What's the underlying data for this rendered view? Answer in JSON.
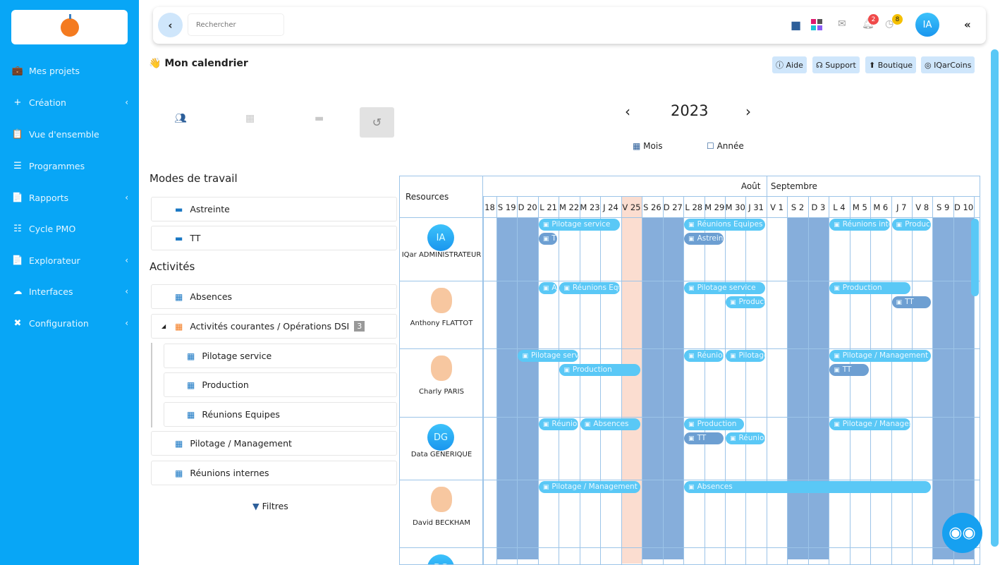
{
  "sidebar": {
    "items": [
      {
        "label": "Mes projets",
        "icon": "briefcase-icon",
        "glyph": "💼",
        "chevron": false
      },
      {
        "label": "Création",
        "icon": "plus-icon",
        "glyph": "+",
        "chevron": true
      },
      {
        "label": "Vue d'ensemble",
        "icon": "clipboard-icon",
        "glyph": "📋",
        "chevron": false
      },
      {
        "label": "Programmes",
        "icon": "list-icon",
        "glyph": "☰",
        "chevron": false
      },
      {
        "label": "Rapports",
        "icon": "file-icon",
        "glyph": "📄",
        "chevron": true
      },
      {
        "label": "Cycle PMO",
        "icon": "tasks-icon",
        "glyph": "☷",
        "chevron": false
      },
      {
        "label": "Explorateur",
        "icon": "file-icon",
        "glyph": "📄",
        "chevron": true
      },
      {
        "label": "Interfaces",
        "icon": "cloud-icon",
        "glyph": "☁",
        "chevron": true
      },
      {
        "label": "Configuration",
        "icon": "tools-icon",
        "glyph": "✖",
        "chevron": true
      }
    ]
  },
  "topbar": {
    "search_placeholder": "Rechercher",
    "notifications": "2",
    "timer": "8",
    "avatar": "IA",
    "collapse": "«"
  },
  "page": {
    "title": "Mon calendrier",
    "emoji": "👋"
  },
  "header_buttons": [
    "Aide",
    "Support",
    "Boutique",
    "IQarCoins"
  ],
  "nav": {
    "year": "2023",
    "prev": "‹",
    "next": "›",
    "mois": "Mois",
    "annee": "Année"
  },
  "left": {
    "modes_title": "Modes de travail",
    "modes": [
      "Astreinte",
      "TT"
    ],
    "activites_title": "Activités",
    "activites": [
      {
        "label": "Absences",
        "level": 0
      },
      {
        "label": "Activités courantes / Opérations DSI",
        "level": 0,
        "badge": "3",
        "expanded": true
      },
      {
        "label": "Pilotage service",
        "level": 1
      },
      {
        "label": "Production",
        "level": 1
      },
      {
        "label": "Réunions Equipes",
        "level": 1
      },
      {
        "label": "Pilotage / Management",
        "level": 0
      },
      {
        "label": "Réunions internes",
        "level": 0
      }
    ],
    "filters": "Filtres"
  },
  "calendar": {
    "resources_header": "Resources",
    "months": [
      {
        "label": "Août",
        "from": 0,
        "to": 13
      },
      {
        "label": "Septembre",
        "from": 14,
        "to": 23
      }
    ],
    "days": [
      {
        "label": "18",
        "date": "2023-08-18"
      },
      {
        "label": "S 19",
        "weekend": true
      },
      {
        "label": "D 20",
        "weekend": true
      },
      {
        "label": "L 21"
      },
      {
        "label": "M 22"
      },
      {
        "label": "M 23"
      },
      {
        "label": "J 24"
      },
      {
        "label": "V 25",
        "today": true
      },
      {
        "label": "S 26",
        "weekend": true
      },
      {
        "label": "D 27",
        "weekend": true
      },
      {
        "label": "L 28"
      },
      {
        "label": "M 29"
      },
      {
        "label": "M 30"
      },
      {
        "label": "J 31"
      },
      {
        "label": "V 1"
      },
      {
        "label": "S 2",
        "weekend": true
      },
      {
        "label": "D 3",
        "weekend": true
      },
      {
        "label": "L 4"
      },
      {
        "label": "M 5"
      },
      {
        "label": "M 6"
      },
      {
        "label": "J 7"
      },
      {
        "label": "V 8"
      },
      {
        "label": "S 9",
        "weekend": true
      },
      {
        "label": "D 10",
        "weekend": true
      }
    ],
    "resources": [
      {
        "name": "IQar ADMINISTRATEUR",
        "initials": "IA",
        "events": [
          {
            "label": "Pilotage service",
            "start": "L 21",
            "end": "J 24",
            "lane": 0
          },
          {
            "label": "TT",
            "start": "L 21",
            "end": "L 21",
            "lane": 1,
            "work": true
          },
          {
            "label": "Réunions Equipes",
            "start": "L 28",
            "end": "J 31",
            "lane": 0
          },
          {
            "label": "Astreinte",
            "start": "L 28",
            "end": "M 29",
            "lane": 1,
            "work": true
          },
          {
            "label": "Réunions internes",
            "start": "L 4",
            "end": "M 6",
            "lane": 0
          },
          {
            "label": "Production",
            "start": "J 7",
            "end": "V 8",
            "lane": 0
          }
        ]
      },
      {
        "name": "Anthony FLATTOT",
        "initials": "",
        "events": [
          {
            "label": "Absences",
            "start": "L 21",
            "end": "L 21",
            "lane": 0
          },
          {
            "label": "Réunions Equipes",
            "start": "M 22",
            "end": "J 24",
            "lane": 0
          },
          {
            "label": "Pilotage service",
            "start": "L 28",
            "end": "J 31",
            "lane": 0
          },
          {
            "label": "Production",
            "start": "M 30",
            "end": "J 31",
            "lane": 1
          },
          {
            "label": "Production",
            "start": "L 4",
            "end": "J 7",
            "lane": 0
          },
          {
            "label": "TT",
            "start": "J 7",
            "end": "V 8",
            "lane": 1,
            "work": true
          }
        ]
      },
      {
        "name": "Charly PARIS",
        "initials": "",
        "events": [
          {
            "label": "Pilotage service",
            "start": "D 20",
            "end": "M 22",
            "lane": 0
          },
          {
            "label": "Production",
            "start": "M 22",
            "end": "V 25",
            "lane": 1
          },
          {
            "label": "Réunions Equipes",
            "start": "L 28",
            "end": "M 29",
            "lane": 0
          },
          {
            "label": "Pilotage service",
            "start": "M 30",
            "end": "J 31",
            "lane": 0
          },
          {
            "label": "Pilotage / Management",
            "start": "L 4",
            "end": "V 8",
            "lane": 0
          },
          {
            "label": "TT",
            "start": "L 4",
            "end": "M 5",
            "lane": 1,
            "work": true
          }
        ]
      },
      {
        "name": "Data GENERIQUE",
        "initials": "DG",
        "events": [
          {
            "label": "Réunions Equipes",
            "start": "L 21",
            "end": "M 22",
            "lane": 0
          },
          {
            "label": "Absences",
            "start": "M 23",
            "end": "V 25",
            "lane": 0
          },
          {
            "label": "Production",
            "start": "L 28",
            "end": "M 30",
            "lane": 0
          },
          {
            "label": "TT",
            "start": "L 28",
            "end": "M 29",
            "lane": 1,
            "work": true
          },
          {
            "label": "Réunions Equipes",
            "start": "M 30",
            "end": "J 31",
            "lane": 1
          },
          {
            "label": "Pilotage / Management",
            "start": "L 4",
            "end": "J 7",
            "lane": 0
          }
        ]
      },
      {
        "name": "David BECKHAM",
        "initials": "",
        "events": [
          {
            "label": "Pilotage / Management",
            "start": "L 21",
            "end": "V 25",
            "lane": 0
          },
          {
            "label": "Absences",
            "start": "L 28",
            "end": "V 8",
            "lane": 0
          }
        ]
      },
      {
        "name": "",
        "initials": "DG",
        "events": []
      }
    ]
  },
  "colors": {
    "sidebar": "#08a6f6",
    "event": "#5ac8f6",
    "work_event": "#6d9fd2",
    "weekend": "#86aedb",
    "today": "#fbddd0",
    "accent": "#1b78c4"
  }
}
